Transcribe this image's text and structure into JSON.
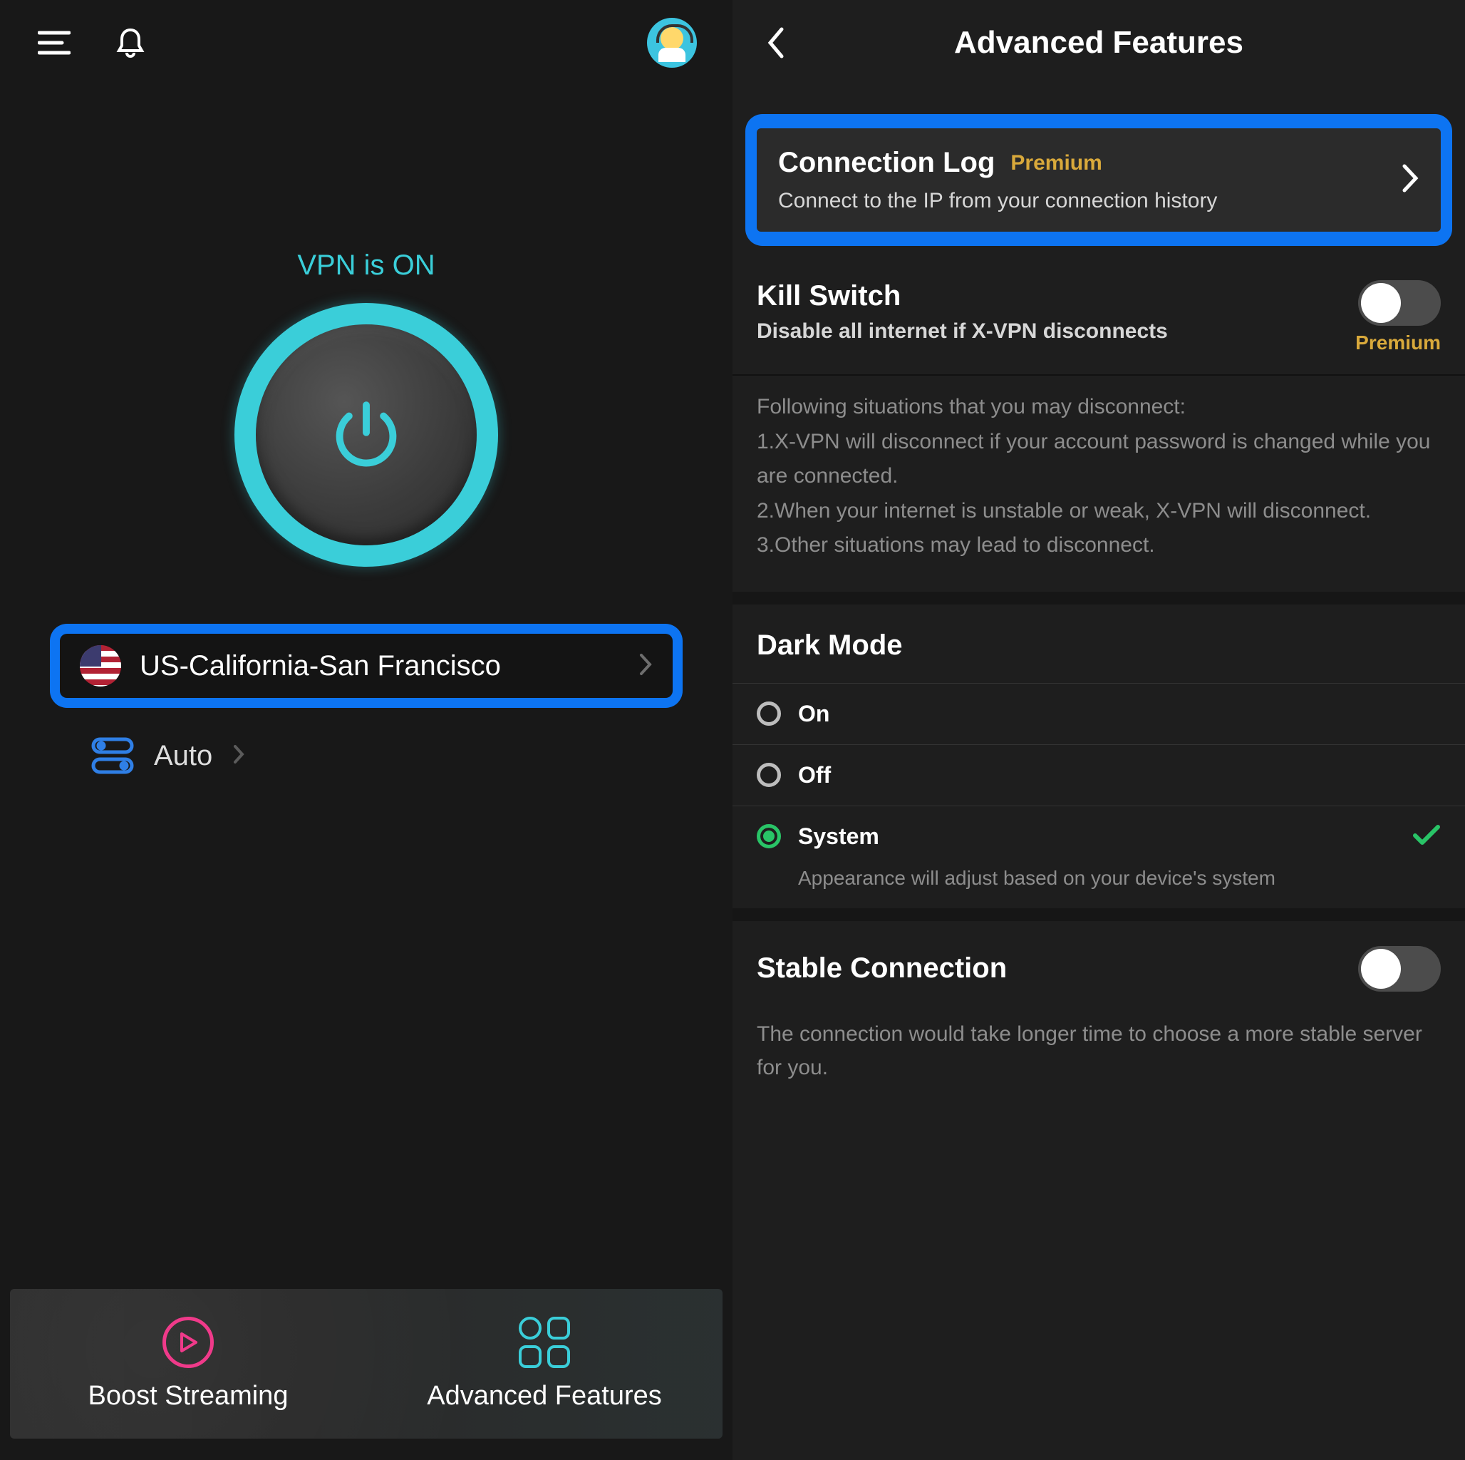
{
  "left": {
    "status": "VPN is ON",
    "server_name": "US-California-San Francisco",
    "auto_label": "Auto",
    "boost_label": "Boost Streaming",
    "adv_label": "Advanced Features"
  },
  "right": {
    "title": "Advanced Features",
    "connection_log": {
      "title": "Connection Log",
      "badge": "Premium",
      "subtitle": "Connect to the IP from your connection history"
    },
    "kill_switch": {
      "title": "Kill Switch",
      "subtitle": "Disable all internet if X-VPN disconnects",
      "badge": "Premium",
      "info_l0": "Following situations that you may disconnect:",
      "info_l1": "1.X-VPN will disconnect if your account password is changed while you are connected.",
      "info_l2": "2.When your internet is unstable or weak, X-VPN will disconnect.",
      "info_l3": "3.Other situations may lead to disconnect."
    },
    "dark_mode": {
      "title": "Dark Mode",
      "on": "On",
      "off": "Off",
      "system": "System",
      "system_sub": "Appearance will adjust based on your device's system"
    },
    "stable": {
      "title": "Stable Connection",
      "info": "The connection would take longer time to choose a more stable server for you."
    }
  }
}
